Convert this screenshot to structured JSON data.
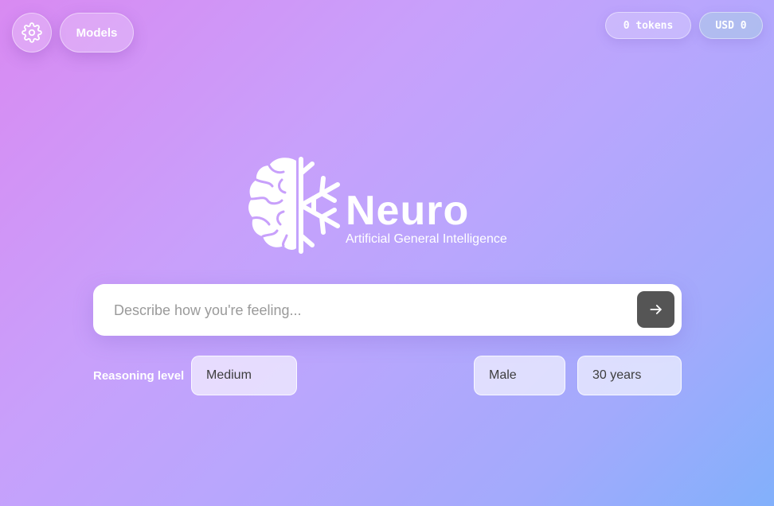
{
  "header": {
    "settings_icon": "gear-icon",
    "models_label": "Models",
    "tokens_label": "0 tokens",
    "usd_label": "USD 0"
  },
  "brand": {
    "name": "Neuro",
    "tagline": "Artificial General Intelligence",
    "logo_icon": "brain-snowflake-logo"
  },
  "search": {
    "placeholder": "Describe how you're feeling...",
    "value": "",
    "send_icon": "arrow-right-icon"
  },
  "options": {
    "reasoning_label": "Reasoning level",
    "reasoning_value": "Medium",
    "gender_value": "Male",
    "age_value": "30 years"
  },
  "colors": {
    "gradient_start": "#d98af2",
    "gradient_mid": "#b9a6fd",
    "gradient_end": "#82b0fb",
    "send_button": "#555555"
  }
}
